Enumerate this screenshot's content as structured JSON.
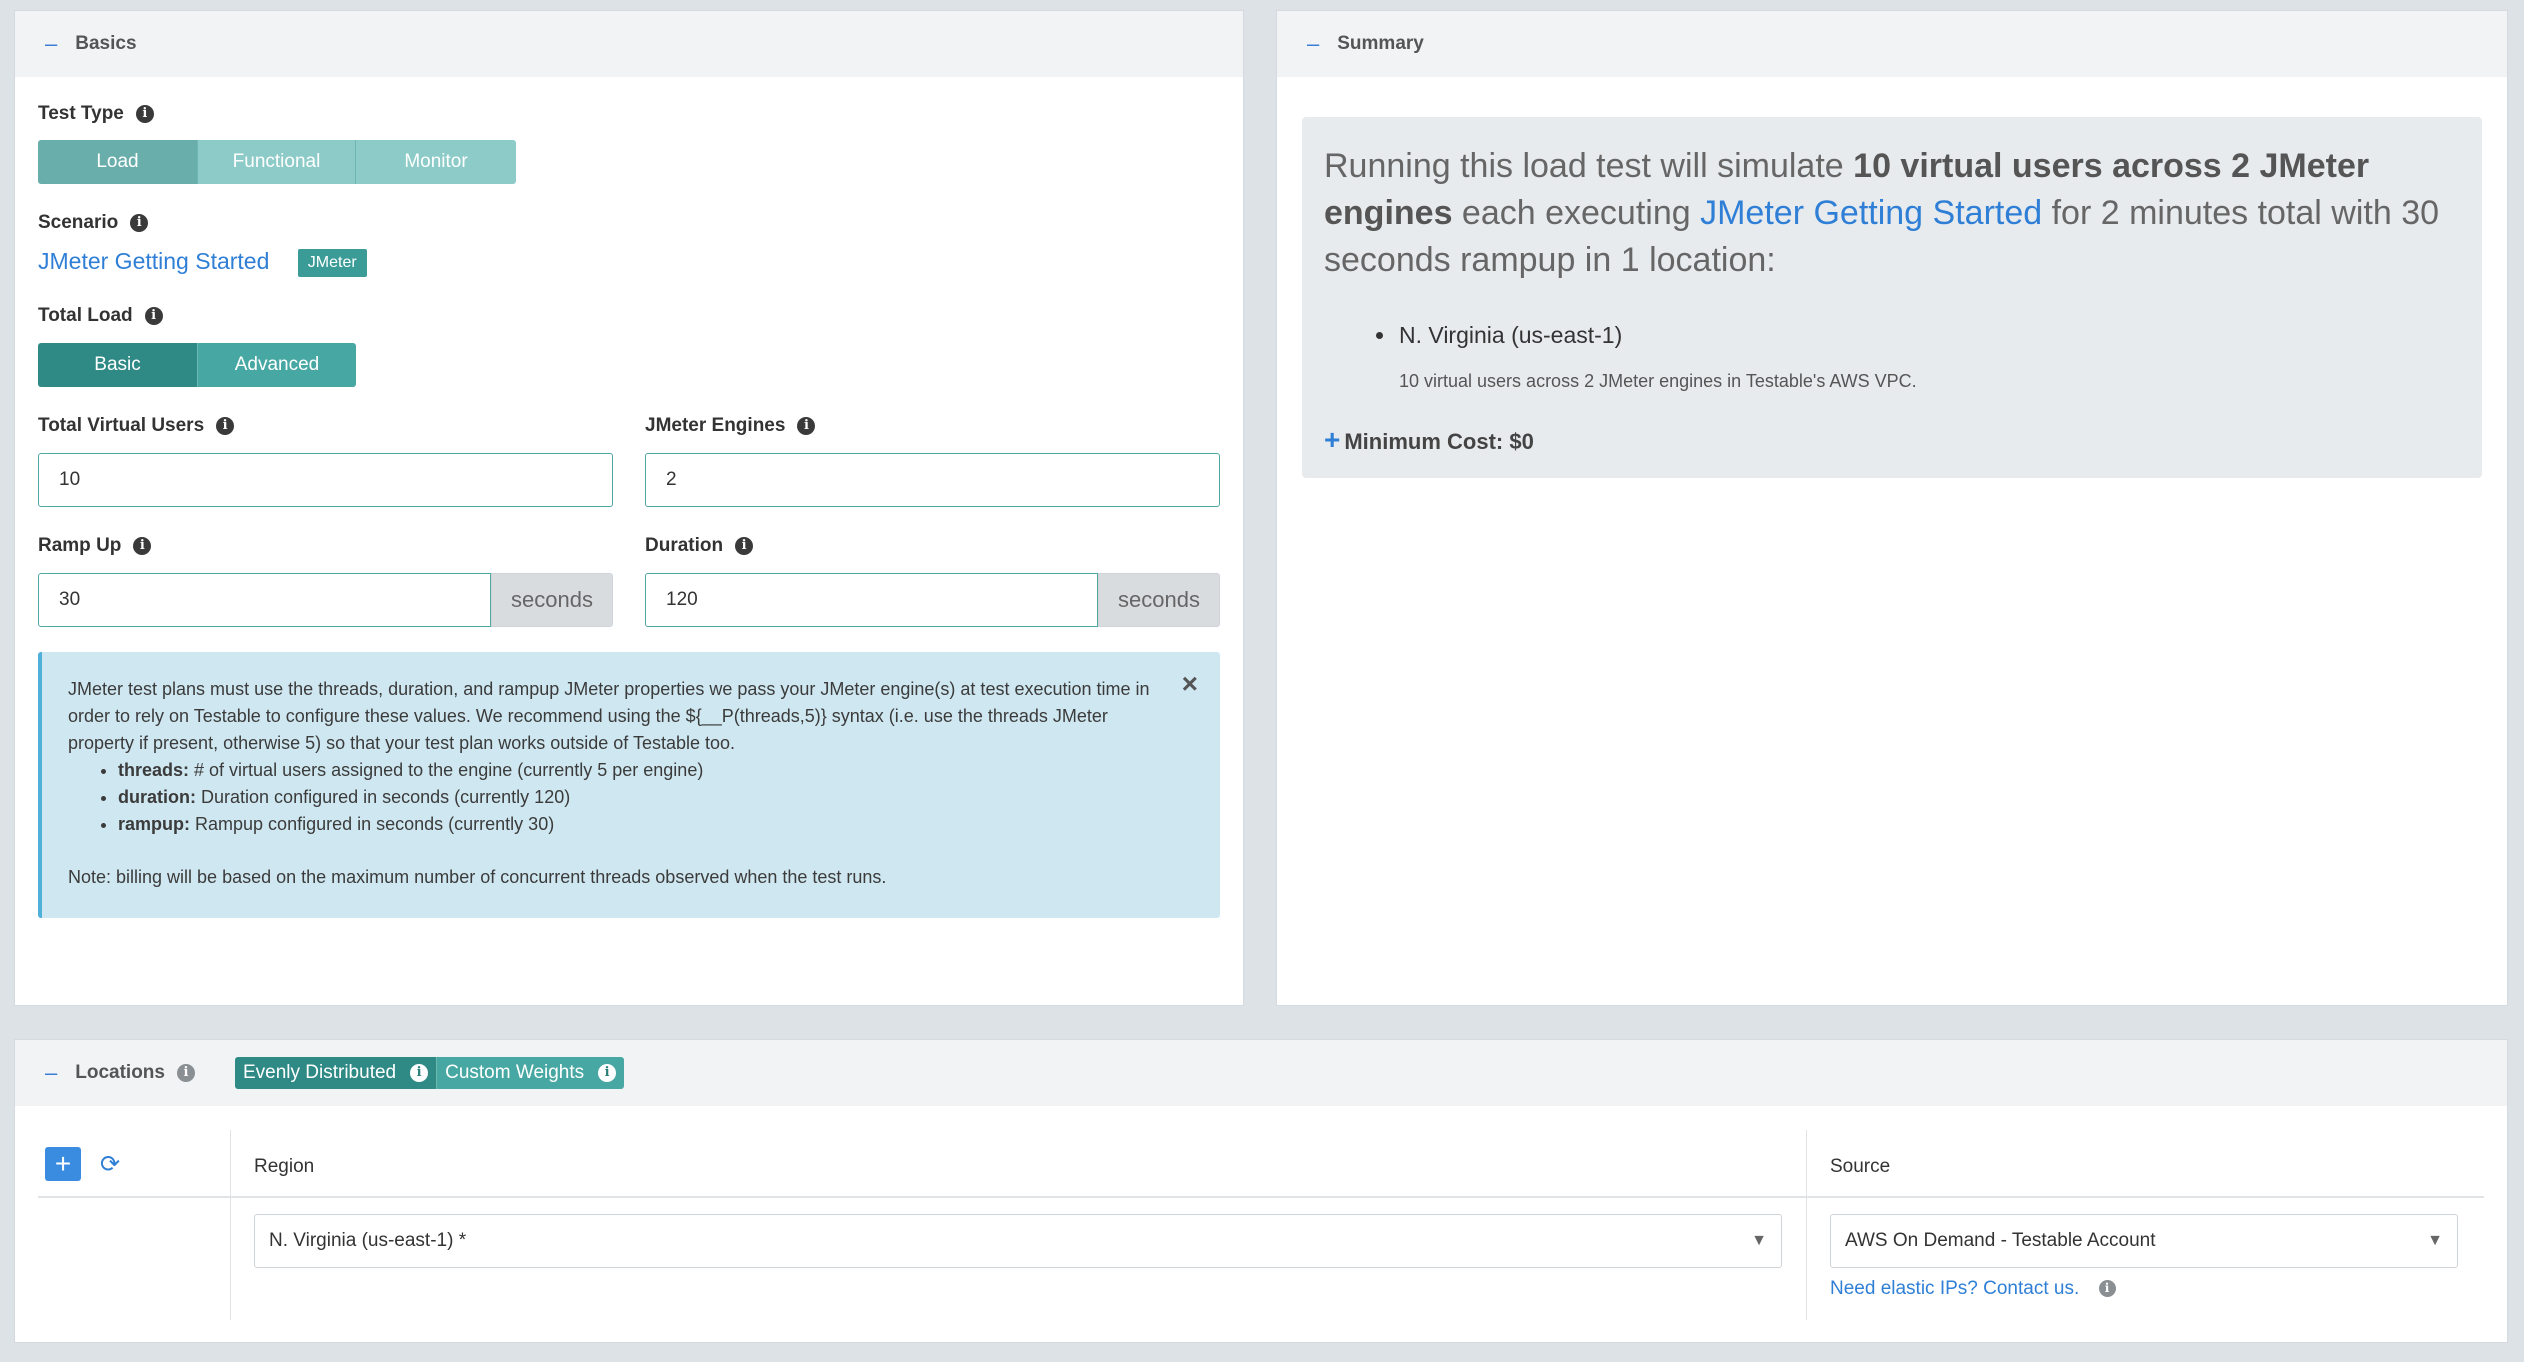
{
  "basics": {
    "header": "Basics",
    "test_type": {
      "label": "Test Type",
      "options": [
        "Load",
        "Functional",
        "Monitor"
      ],
      "selected": "Load"
    },
    "scenario": {
      "label": "Scenario",
      "name": "JMeter Getting Started",
      "badge": "JMeter"
    },
    "total_load": {
      "label": "Total Load",
      "options": [
        "Basic",
        "Advanced"
      ],
      "selected": "Basic"
    },
    "virtual_users": {
      "label": "Total Virtual Users",
      "value": "10"
    },
    "engines": {
      "label": "JMeter Engines",
      "value": "2"
    },
    "ramp_up": {
      "label": "Ramp Up",
      "value": "30",
      "unit": "seconds"
    },
    "duration": {
      "label": "Duration",
      "value": "120",
      "unit": "seconds"
    },
    "alert": {
      "text": "JMeter test plans must use the threads, duration, and rampup JMeter properties we pass your JMeter engine(s) at test execution time in order to rely on Testable to configure these values. We recommend using the ${__P(threads,5)} syntax (i.e. use the threads JMeter property if present, otherwise 5) so that your test plan works outside of Testable too.",
      "items": [
        {
          "key": "threads:",
          "desc": "# of virtual users assigned to the engine (currently 5 per engine)"
        },
        {
          "key": "duration:",
          "desc": "Duration configured in seconds (currently 120)"
        },
        {
          "key": "rampup:",
          "desc": "Rampup configured in seconds (currently 30)"
        }
      ],
      "note": "Note: billing will be based on the maximum number of concurrent threads observed when the test runs.",
      "close": "×"
    }
  },
  "summary": {
    "header": "Summary",
    "part1": "Running this load test will simulate ",
    "bold1": "10 virtual users across 2 JMeter engines",
    "part2": " each executing ",
    "link": "JMeter Getting Started",
    "part3": " for 2 minutes total with 30 seconds rampup in 1 location:",
    "location": "N. Virginia (us-east-1)",
    "location_detail": "10 virtual users across 2 JMeter engines in Testable's AWS VPC.",
    "min_cost": "Minimum Cost: $0"
  },
  "locations": {
    "header": "Locations",
    "modes": [
      "Evenly Distributed",
      "Custom Weights"
    ],
    "selected_mode": "Evenly Distributed",
    "columns": {
      "region": "Region",
      "source": "Source"
    },
    "rows": [
      {
        "region": "N. Virginia (us-east-1) *",
        "source": "AWS On Demand - Testable Account"
      }
    ],
    "elastic_link": "Need elastic IPs? Contact us."
  },
  "colors": {
    "teal_dark": "#2f8a86",
    "teal_light": "#8ccbc7",
    "link_blue": "#2f7fd6",
    "alert_bg": "#cfe7f0"
  }
}
